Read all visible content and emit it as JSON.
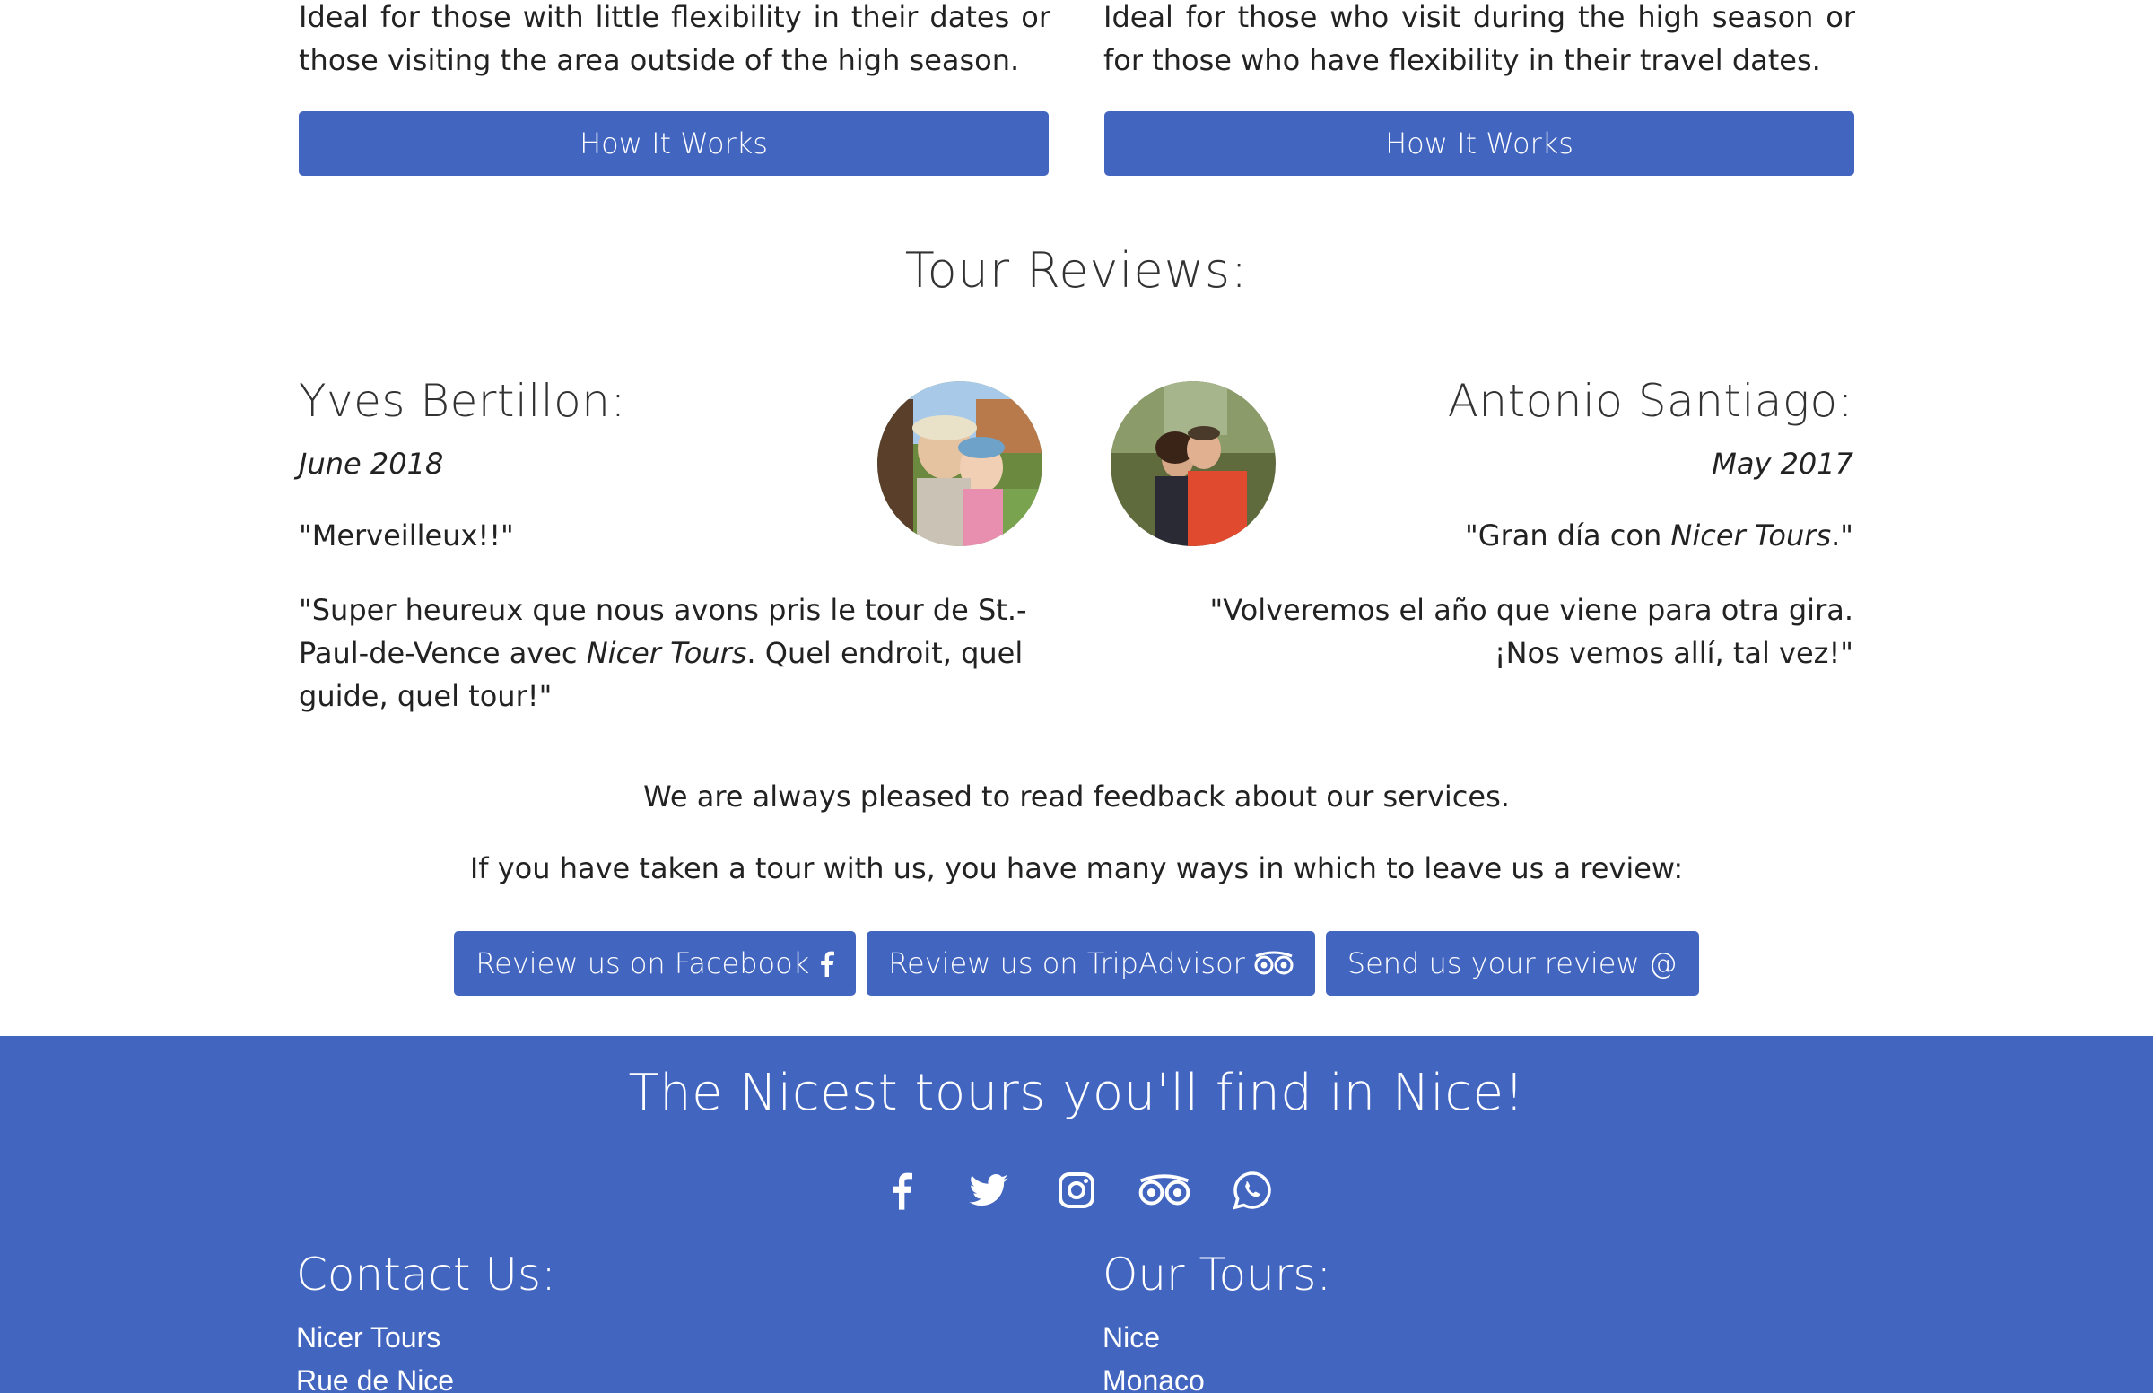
{
  "tours": {
    "left_description": "Ideal for those with little flexibility in their dates or those visiting the area outside of the high season.",
    "right_description": "Ideal for those who visit during the high season or for those who have flexibility in their travel dates.",
    "left_button": "How It Works",
    "right_button": "How It Works"
  },
  "reviews": {
    "title": "Tour Reviews:",
    "items": [
      {
        "name": "Yves Bertillon:",
        "date": "June 2018",
        "quote": "\"Merveilleux!!\"",
        "body_before": "\"Super heureux que nous avons pris le tour de St.-Paul-de-Vence avec ",
        "body_italic": "Nicer Tours",
        "body_after": ". Quel endroit, quel guide, quel tour!\""
      },
      {
        "name": "Antonio Santiago:",
        "date": "May 2017",
        "quote_before": "\"Gran día con ",
        "quote_italic": "Nicer Tours",
        "quote_after": ".\"",
        "body": "\"Volveremos el año que viene para otra gira. ¡Nos vemos allí, tal vez!\""
      }
    ],
    "feedback_line": "We are always pleased to read feedback about our services.",
    "invite_line": "If you have taken a tour with us, you have many ways in which to leave us a review:",
    "buttons": {
      "facebook": "Review us on Facebook",
      "tripadvisor": "Review us on TripAdvisor",
      "email": "Send us your review"
    }
  },
  "footer": {
    "tagline": "The Nicest tours you'll find in Nice!",
    "social_icons": [
      "facebook-icon",
      "twitter-icon",
      "instagram-icon",
      "tripadvisor-icon",
      "whatsapp-icon"
    ],
    "contact_heading": "Contact Us:",
    "contact_lines": [
      "Nicer Tours",
      "Rue de Nice"
    ],
    "tours_heading": "Our Tours:",
    "tours_lines": [
      "Nice",
      "Monaco"
    ]
  },
  "colors": {
    "accent": "#4265c0",
    "text": "#222222",
    "background": "#ffffff"
  }
}
